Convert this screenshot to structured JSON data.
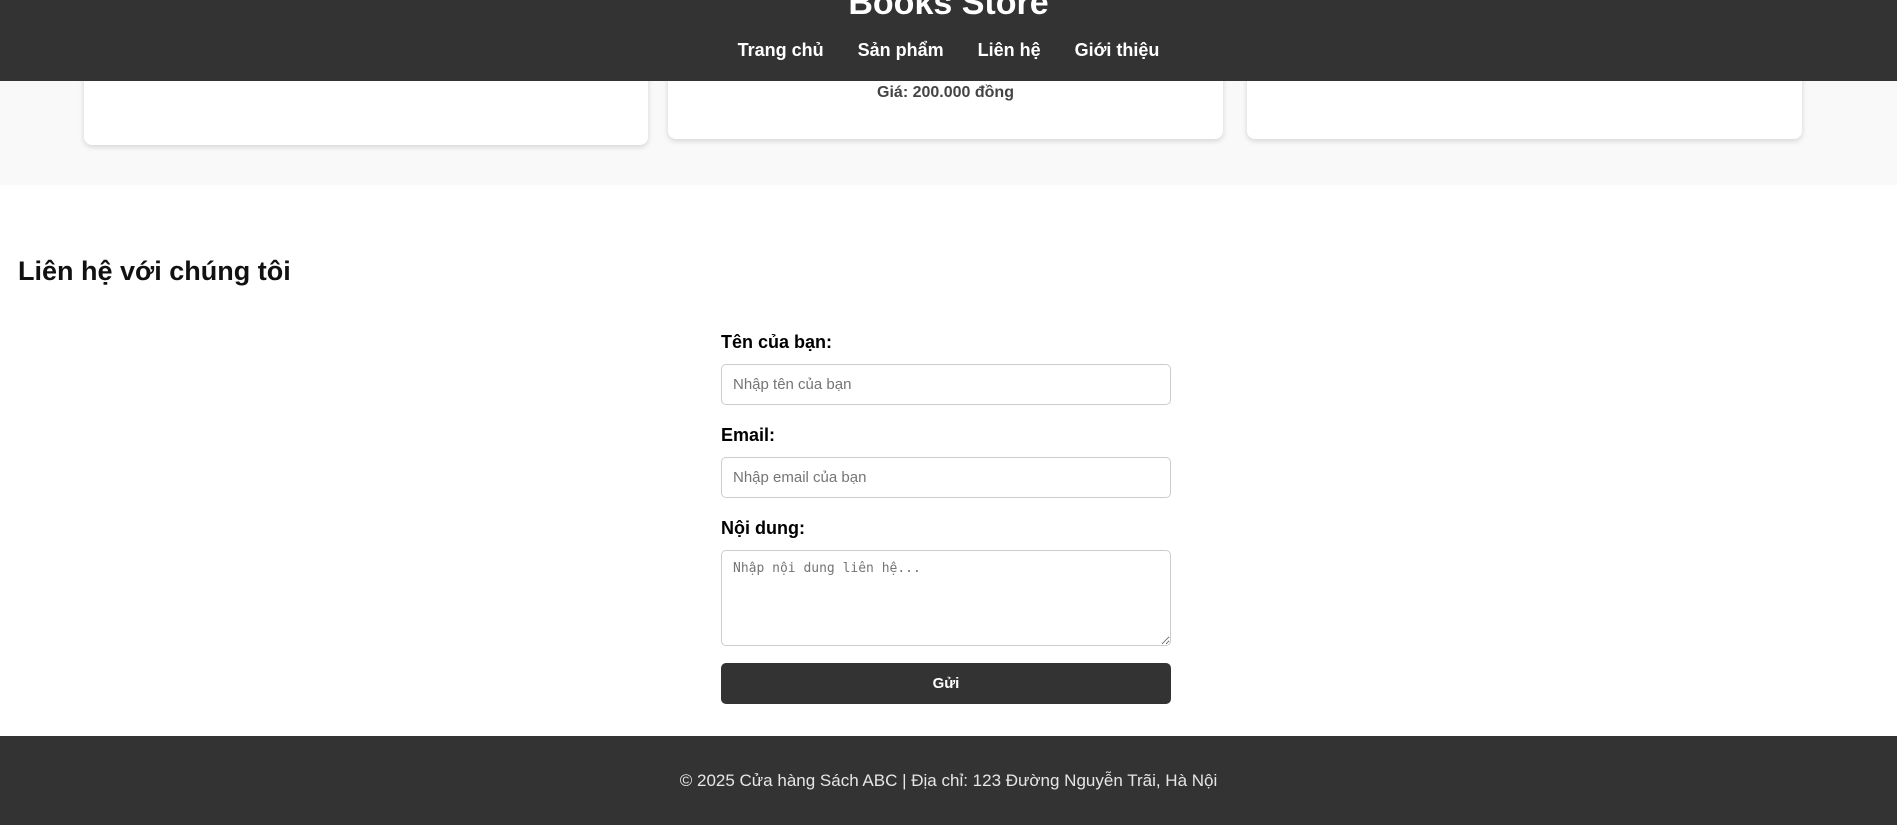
{
  "header": {
    "title": "Books Store",
    "nav": [
      {
        "label": "Trang chủ"
      },
      {
        "label": "Sản phẩm"
      },
      {
        "label": "Liên hệ"
      },
      {
        "label": "Giới thiệu"
      }
    ]
  },
  "products": {
    "cards": [
      {
        "price": ""
      },
      {
        "price": "Giá: 200.000 đồng"
      },
      {
        "price": ""
      }
    ]
  },
  "contact": {
    "title": "Liên hệ với chúng tôi",
    "name_label": "Tên của bạn:",
    "name_placeholder": "Nhập tên của bạn",
    "email_label": "Email:",
    "email_placeholder": "Nhập email của bạn",
    "message_label": "Nội dung:",
    "message_placeholder": "Nhập nội dung liên hệ...",
    "submit_label": "Gửi"
  },
  "footer": {
    "text": "© 2025 Cửa hàng Sách ABC | Địa chỉ: 123 Đường Nguyễn Trãi, Hà Nội"
  },
  "colors": {
    "header_bg": "#333333",
    "footer_bg": "#333333",
    "band_bg": "#f9f9f9",
    "button_bg": "#333333"
  }
}
